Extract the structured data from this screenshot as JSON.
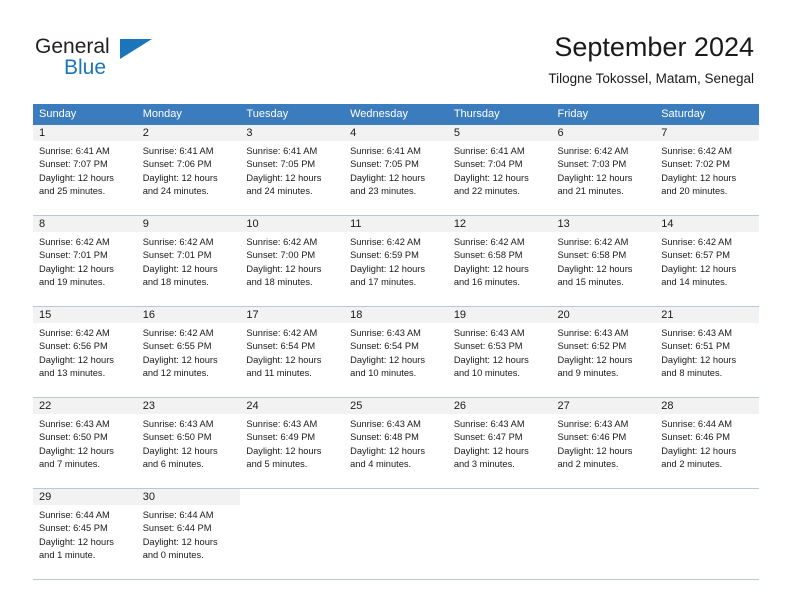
{
  "logo": {
    "word_one": "General",
    "word_two": "Blue",
    "triangle_icon": "blue-triangle-icon",
    "color_dark": "#231f20",
    "color_blue": "#1b75bb"
  },
  "header": {
    "title": "September 2024",
    "subtitle": "Tilogne Tokossel, Matam, Senegal"
  },
  "theme": {
    "header_row_bg": "#3a7cbe",
    "header_row_text": "#ffffff",
    "day_band_bg": "#f2f2f2",
    "row_border": "#b9c7d6",
    "text": "#1a1a1a"
  },
  "weekdays": [
    "Sunday",
    "Monday",
    "Tuesday",
    "Wednesday",
    "Thursday",
    "Friday",
    "Saturday"
  ],
  "weeks": [
    [
      {
        "day": "1",
        "sunrise": "Sunrise: 6:41 AM",
        "sunset": "Sunset: 7:07 PM",
        "daylight1": "Daylight: 12 hours",
        "daylight2": "and 25 minutes."
      },
      {
        "day": "2",
        "sunrise": "Sunrise: 6:41 AM",
        "sunset": "Sunset: 7:06 PM",
        "daylight1": "Daylight: 12 hours",
        "daylight2": "and 24 minutes."
      },
      {
        "day": "3",
        "sunrise": "Sunrise: 6:41 AM",
        "sunset": "Sunset: 7:05 PM",
        "daylight1": "Daylight: 12 hours",
        "daylight2": "and 24 minutes."
      },
      {
        "day": "4",
        "sunrise": "Sunrise: 6:41 AM",
        "sunset": "Sunset: 7:05 PM",
        "daylight1": "Daylight: 12 hours",
        "daylight2": "and 23 minutes."
      },
      {
        "day": "5",
        "sunrise": "Sunrise: 6:41 AM",
        "sunset": "Sunset: 7:04 PM",
        "daylight1": "Daylight: 12 hours",
        "daylight2": "and 22 minutes."
      },
      {
        "day": "6",
        "sunrise": "Sunrise: 6:42 AM",
        "sunset": "Sunset: 7:03 PM",
        "daylight1": "Daylight: 12 hours",
        "daylight2": "and 21 minutes."
      },
      {
        "day": "7",
        "sunrise": "Sunrise: 6:42 AM",
        "sunset": "Sunset: 7:02 PM",
        "daylight1": "Daylight: 12 hours",
        "daylight2": "and 20 minutes."
      }
    ],
    [
      {
        "day": "8",
        "sunrise": "Sunrise: 6:42 AM",
        "sunset": "Sunset: 7:01 PM",
        "daylight1": "Daylight: 12 hours",
        "daylight2": "and 19 minutes."
      },
      {
        "day": "9",
        "sunrise": "Sunrise: 6:42 AM",
        "sunset": "Sunset: 7:01 PM",
        "daylight1": "Daylight: 12 hours",
        "daylight2": "and 18 minutes."
      },
      {
        "day": "10",
        "sunrise": "Sunrise: 6:42 AM",
        "sunset": "Sunset: 7:00 PM",
        "daylight1": "Daylight: 12 hours",
        "daylight2": "and 18 minutes."
      },
      {
        "day": "11",
        "sunrise": "Sunrise: 6:42 AM",
        "sunset": "Sunset: 6:59 PM",
        "daylight1": "Daylight: 12 hours",
        "daylight2": "and 17 minutes."
      },
      {
        "day": "12",
        "sunrise": "Sunrise: 6:42 AM",
        "sunset": "Sunset: 6:58 PM",
        "daylight1": "Daylight: 12 hours",
        "daylight2": "and 16 minutes."
      },
      {
        "day": "13",
        "sunrise": "Sunrise: 6:42 AM",
        "sunset": "Sunset: 6:58 PM",
        "daylight1": "Daylight: 12 hours",
        "daylight2": "and 15 minutes."
      },
      {
        "day": "14",
        "sunrise": "Sunrise: 6:42 AM",
        "sunset": "Sunset: 6:57 PM",
        "daylight1": "Daylight: 12 hours",
        "daylight2": "and 14 minutes."
      }
    ],
    [
      {
        "day": "15",
        "sunrise": "Sunrise: 6:42 AM",
        "sunset": "Sunset: 6:56 PM",
        "daylight1": "Daylight: 12 hours",
        "daylight2": "and 13 minutes."
      },
      {
        "day": "16",
        "sunrise": "Sunrise: 6:42 AM",
        "sunset": "Sunset: 6:55 PM",
        "daylight1": "Daylight: 12 hours",
        "daylight2": "and 12 minutes."
      },
      {
        "day": "17",
        "sunrise": "Sunrise: 6:42 AM",
        "sunset": "Sunset: 6:54 PM",
        "daylight1": "Daylight: 12 hours",
        "daylight2": "and 11 minutes."
      },
      {
        "day": "18",
        "sunrise": "Sunrise: 6:43 AM",
        "sunset": "Sunset: 6:54 PM",
        "daylight1": "Daylight: 12 hours",
        "daylight2": "and 10 minutes."
      },
      {
        "day": "19",
        "sunrise": "Sunrise: 6:43 AM",
        "sunset": "Sunset: 6:53 PM",
        "daylight1": "Daylight: 12 hours",
        "daylight2": "and 10 minutes."
      },
      {
        "day": "20",
        "sunrise": "Sunrise: 6:43 AM",
        "sunset": "Sunset: 6:52 PM",
        "daylight1": "Daylight: 12 hours",
        "daylight2": "and 9 minutes."
      },
      {
        "day": "21",
        "sunrise": "Sunrise: 6:43 AM",
        "sunset": "Sunset: 6:51 PM",
        "daylight1": "Daylight: 12 hours",
        "daylight2": "and 8 minutes."
      }
    ],
    [
      {
        "day": "22",
        "sunrise": "Sunrise: 6:43 AM",
        "sunset": "Sunset: 6:50 PM",
        "daylight1": "Daylight: 12 hours",
        "daylight2": "and 7 minutes."
      },
      {
        "day": "23",
        "sunrise": "Sunrise: 6:43 AM",
        "sunset": "Sunset: 6:50 PM",
        "daylight1": "Daylight: 12 hours",
        "daylight2": "and 6 minutes."
      },
      {
        "day": "24",
        "sunrise": "Sunrise: 6:43 AM",
        "sunset": "Sunset: 6:49 PM",
        "daylight1": "Daylight: 12 hours",
        "daylight2": "and 5 minutes."
      },
      {
        "day": "25",
        "sunrise": "Sunrise: 6:43 AM",
        "sunset": "Sunset: 6:48 PM",
        "daylight1": "Daylight: 12 hours",
        "daylight2": "and 4 minutes."
      },
      {
        "day": "26",
        "sunrise": "Sunrise: 6:43 AM",
        "sunset": "Sunset: 6:47 PM",
        "daylight1": "Daylight: 12 hours",
        "daylight2": "and 3 minutes."
      },
      {
        "day": "27",
        "sunrise": "Sunrise: 6:43 AM",
        "sunset": "Sunset: 6:46 PM",
        "daylight1": "Daylight: 12 hours",
        "daylight2": "and 2 minutes."
      },
      {
        "day": "28",
        "sunrise": "Sunrise: 6:44 AM",
        "sunset": "Sunset: 6:46 PM",
        "daylight1": "Daylight: 12 hours",
        "daylight2": "and 2 minutes."
      }
    ],
    [
      {
        "day": "29",
        "sunrise": "Sunrise: 6:44 AM",
        "sunset": "Sunset: 6:45 PM",
        "daylight1": "Daylight: 12 hours",
        "daylight2": "and 1 minute."
      },
      {
        "day": "30",
        "sunrise": "Sunrise: 6:44 AM",
        "sunset": "Sunset: 6:44 PM",
        "daylight1": "Daylight: 12 hours",
        "daylight2": "and 0 minutes."
      },
      {
        "day": "",
        "sunrise": "",
        "sunset": "",
        "daylight1": "",
        "daylight2": ""
      },
      {
        "day": "",
        "sunrise": "",
        "sunset": "",
        "daylight1": "",
        "daylight2": ""
      },
      {
        "day": "",
        "sunrise": "",
        "sunset": "",
        "daylight1": "",
        "daylight2": ""
      },
      {
        "day": "",
        "sunrise": "",
        "sunset": "",
        "daylight1": "",
        "daylight2": ""
      },
      {
        "day": "",
        "sunrise": "",
        "sunset": "",
        "daylight1": "",
        "daylight2": ""
      }
    ]
  ]
}
